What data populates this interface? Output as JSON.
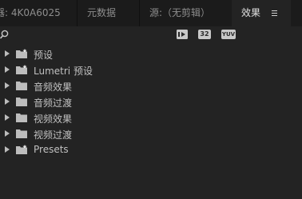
{
  "tabs": [
    {
      "label": "器: 4K0A6025"
    },
    {
      "label": "元数据"
    },
    {
      "label": "源:（无剪辑）"
    },
    {
      "label": "效果"
    }
  ],
  "toolbar": {
    "buttons": [
      {
        "label": "32"
      },
      {
        "label": "YUV"
      }
    ]
  },
  "tree": [
    {
      "label": "预设",
      "icon": "preset-folder-icon"
    },
    {
      "label": "Lumetri 预设",
      "icon": "preset-folder-icon"
    },
    {
      "label": "音频效果",
      "icon": "folder-icon"
    },
    {
      "label": "音频过渡",
      "icon": "folder-icon"
    },
    {
      "label": "视频效果",
      "icon": "folder-icon"
    },
    {
      "label": "视频过渡",
      "icon": "folder-icon"
    },
    {
      "label": "Presets",
      "icon": "preset-folder-icon"
    }
  ],
  "colors": {
    "panel_bg": "#232323",
    "tabbar_bg": "#1b1b1b",
    "text": "#c0c0c0"
  }
}
